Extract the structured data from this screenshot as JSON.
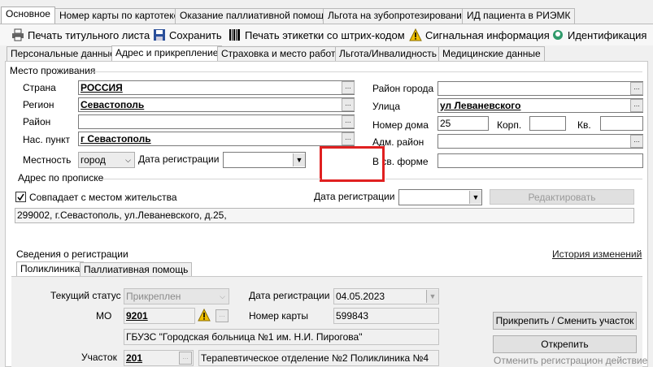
{
  "top_tabs": [
    "Основное",
    "Номер карты по картотеке",
    "Оказание паллиативной помощи",
    "Льгота на зубопротезирование",
    "ИД пациента в РИЭМК"
  ],
  "toolbar": {
    "print_title": "Печать титульного листа",
    "save": "Сохранить",
    "print_barcode": "Печать этикетки со штрих-кодом",
    "signal_info": "Сигнальная информация",
    "identification": "Идентификация"
  },
  "sub_tabs": [
    "Персональные данные",
    "Адрес и прикрепление",
    "Страховка и место работы",
    "Льгота/Инвалидность",
    "Медицинские данные"
  ],
  "residence": {
    "group_title": "Место проживания",
    "country_label": "Страна",
    "country_value": "РОССИЯ",
    "region_label": "Регион",
    "region_value": "Севастополь",
    "district_label": "Район",
    "district_value": "",
    "settlement_label": "Нас. пункт",
    "settlement_value": "г Севастополь",
    "locality_label": "Местность",
    "locality_value": "город",
    "reg_date_label": "Дата регистрации",
    "reg_date_value": "",
    "city_district_label": "Район города",
    "city_district_value": "",
    "street_label": "Улица",
    "street_value": "ул Леваневского",
    "house_label": "Номер дома",
    "house_value": "25",
    "building_label": "Корп.",
    "building_value": "",
    "apt_label": "Кв.",
    "apt_value": "",
    "adm_district_label": "Адм. район",
    "adm_district_value": "",
    "free_form_label": "В св. форме",
    "free_form_value": ""
  },
  "registration_address": {
    "group_title": "Адрес по прописке",
    "same_as_residence": "Совпадает с местом жительства",
    "reg_date_label": "Дата регистрации",
    "reg_date_value": "",
    "edit_button": "Редактировать",
    "full_address": "299002, г.Севастополь, ул.Леваневского, д.25,"
  },
  "registration_info": {
    "group_title": "Сведения о регистрации",
    "history_link": "История изменений",
    "tabs": [
      "Поликлиника",
      "Паллиативная помощь"
    ],
    "status_label": "Текущий статус",
    "status_value": "Прикреплен",
    "reg_date_label": "Дата регистрации",
    "reg_date_value": "04.05.2023",
    "mo_label": "МО",
    "mo_code": "9201",
    "card_label": "Номер карты",
    "card_value": "599843",
    "mo_name": "ГБУЗС \"Городская больница №1 им. Н.И. Пирогова\"",
    "area_label": "Участок",
    "area_code": "201",
    "area_name": "Терапевтическое отделение №2 Поликлиника №4",
    "attach_button": "Прикрепить / Сменить участок",
    "detach_button": "Открепить",
    "cancel_reg_link": "Отменить регистрацион действие"
  },
  "colors": {
    "highlight_box": "#e02020",
    "warning": "#f0c000"
  }
}
